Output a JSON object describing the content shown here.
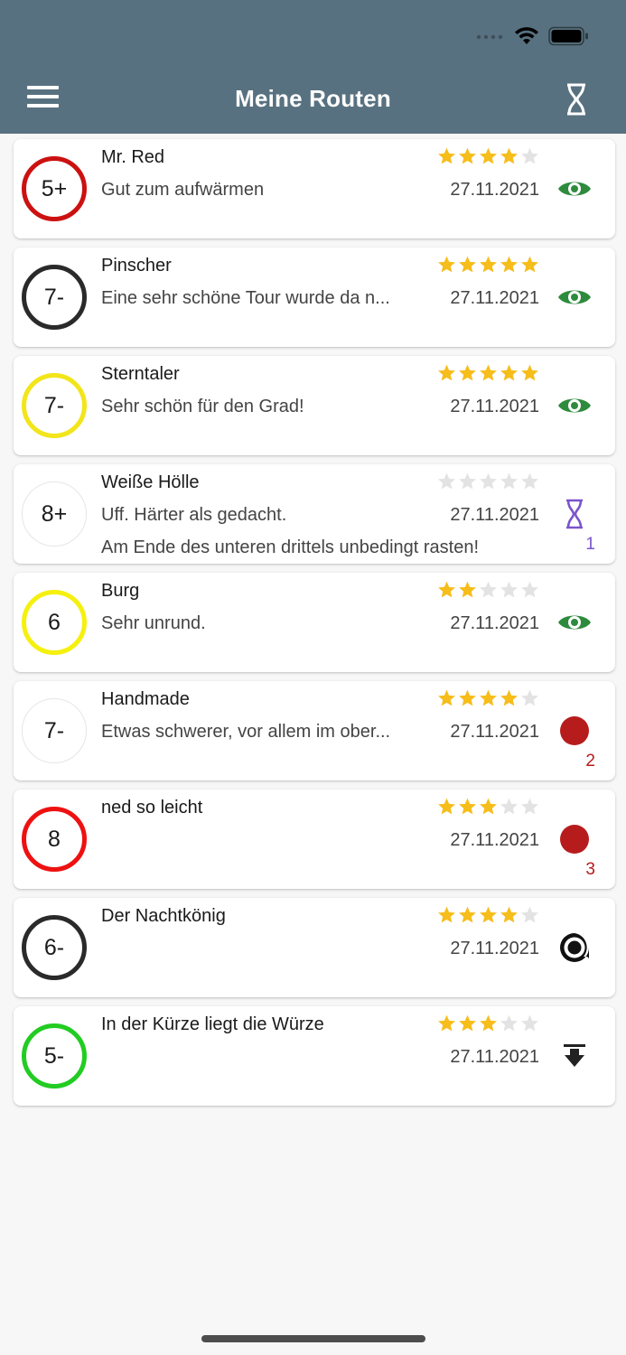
{
  "header": {
    "title": "Meine Routen",
    "menu_icon": "hamburger-menu-icon",
    "action_icon": "hourglass-icon",
    "background": "#587180"
  },
  "colors": {
    "star_filled": "#f6bd1b",
    "star_empty": "#e3e3e3",
    "seen_green": "#2e8b3d",
    "project_red": "#b71c1c",
    "pending_purple": "#7a55cc"
  },
  "routes": [
    {
      "name": "Mr. Red",
      "comment": "Gut zum aufwärmen",
      "note": "",
      "date": "27.11.2021",
      "grade": "5+",
      "circle_color": "#cc1111",
      "circle_style": "thick",
      "rating": 4,
      "status_icon": "eye-icon",
      "count": ""
    },
    {
      "name": "Pinscher",
      "comment": "Eine sehr schöne Tour wurde da n...",
      "note": "",
      "date": "27.11.2021",
      "grade": "7-",
      "circle_color": "#2a2a2a",
      "circle_style": "thick",
      "rating": 5,
      "status_icon": "eye-icon",
      "count": ""
    },
    {
      "name": "Sterntaler",
      "comment": "Sehr schön für den Grad!",
      "note": "",
      "date": "27.11.2021",
      "grade": "7-",
      "circle_color": "#f2e51a",
      "circle_style": "thick",
      "rating": 5,
      "status_icon": "eye-icon",
      "count": ""
    },
    {
      "name": "Weiße Hölle",
      "comment": "Uff. Härter als gedacht.",
      "note": "Am Ende des unteren drittels unbedingt rasten!",
      "date": "27.11.2021",
      "grade": "8+",
      "circle_color": "#e6e6e6",
      "circle_style": "thin",
      "rating": 0,
      "status_icon": "hourglass-icon",
      "count": "1"
    },
    {
      "name": "Burg",
      "comment": "Sehr unrund.",
      "note": "",
      "date": "27.11.2021",
      "grade": "6",
      "circle_color": "#f5f00e",
      "circle_style": "thick",
      "rating": 2,
      "status_icon": "eye-icon",
      "count": ""
    },
    {
      "name": "Handmade",
      "comment": "Etwas schwerer, vor allem im ober...",
      "note": "",
      "date": "27.11.2021",
      "grade": "7-",
      "circle_color": "#e6e6e6",
      "circle_style": "thin",
      "rating": 4,
      "status_icon": "red-dot-icon",
      "count": "2"
    },
    {
      "name": "ned so leicht",
      "comment": "",
      "note": "",
      "date": "27.11.2021",
      "grade": "8",
      "circle_color": "#ee1111",
      "circle_style": "thick",
      "rating": 3,
      "status_icon": "red-dot-icon",
      "count": "3"
    },
    {
      "name": "Der Nachtkönig",
      "comment": "",
      "note": "",
      "date": "27.11.2021",
      "grade": "6-",
      "circle_color": "#2a2a2a",
      "circle_style": "thick",
      "rating": 4,
      "status_icon": "target-flag-icon",
      "count": ""
    },
    {
      "name": "In der Kürze liegt die Würze",
      "comment": "",
      "note": "",
      "date": "27.11.2021",
      "grade": "5-",
      "circle_color": "#22cc22",
      "circle_style": "thick",
      "rating": 3,
      "status_icon": "download-icon",
      "count": ""
    }
  ]
}
